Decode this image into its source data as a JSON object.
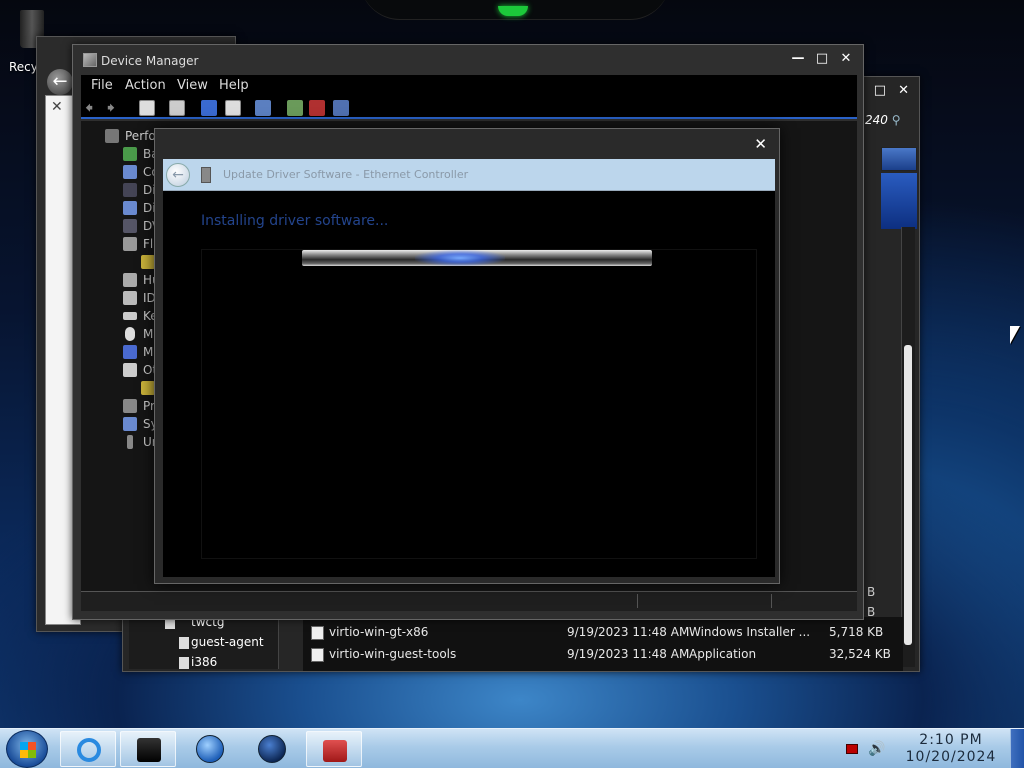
{
  "desktop": {
    "recycle_bin_label": "Recy"
  },
  "explorer": {
    "search_partial": "240",
    "tree": [
      {
        "label": "twctg"
      },
      {
        "label": "guest-agent"
      },
      {
        "label": "i386"
      }
    ],
    "files": [
      {
        "name": "virtio-win-gt-x86",
        "date": "9/19/2023 11:48 AM",
        "type": "Windows Installer ...",
        "size": "5,718 KB"
      },
      {
        "name": "virtio-win-guest-tools",
        "date": "9/19/2023 11:48 AM",
        "type": "Application",
        "size": "32,524 KB"
      }
    ],
    "size_fragment_1": "B",
    "size_fragment_2": "B"
  },
  "device_manager": {
    "title": "Device Manager",
    "menu": [
      "File",
      "Action",
      "View",
      "Help"
    ],
    "tree_root": "Perfo",
    "tree_nodes": [
      "Ba",
      "Co",
      "Di",
      "Di",
      "DV",
      "Fl",
      "",
      "Hu",
      "ID",
      "Ke",
      "M",
      "M",
      "Ot",
      "",
      "Pr",
      "Sy",
      "Ur"
    ]
  },
  "update_dialog": {
    "header_title": "Update Driver Software - Ethernet Controller",
    "message": "Installing driver software...",
    "progress_fraction": 0.45
  },
  "taskbar": {
    "clock_time": "2:10 PM",
    "clock_date": "10/20/2024"
  }
}
